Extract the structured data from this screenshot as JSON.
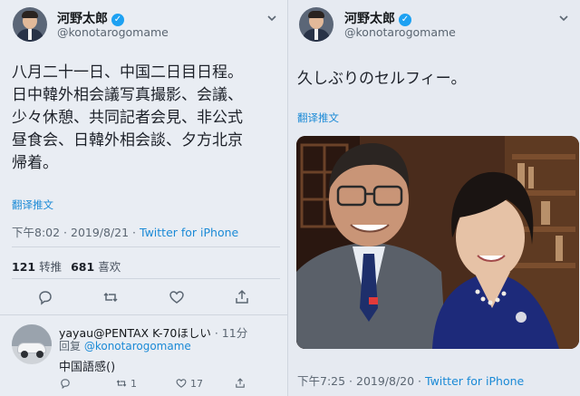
{
  "left_tweet": {
    "author_name": "河野太郎",
    "author_handle": "@konotarogomame",
    "text_lines": [
      "八月二十一日、中国二日目日程。",
      "日中韓外相会議写真撮影、会議、",
      "少々休憩、共同記者会見、非公式",
      "昼食会、日韓外相会談、夕方北京",
      "帰着。"
    ],
    "translate_label": "翻译推文",
    "time": "下午8:02 · 2019/8/21 · ",
    "source": "Twitter for iPhone",
    "retweets_count": "121",
    "retweets_label": "转推",
    "likes_count": "681",
    "likes_label": "喜欢"
  },
  "reply": {
    "name": "yayau@PENTAX K-70ほしい",
    "time": " · 11分",
    "reply_prefix": "回复 ",
    "reply_mention": "@konotarogomame",
    "text": "中国語感()",
    "retweet_count": "1",
    "like_count": "17"
  },
  "right_tweet": {
    "author_name": "河野太郎",
    "author_handle": "@konotarogomame",
    "text": "久しぶりのセルフィー。",
    "translate_label": "翻译推文",
    "time": "下午7:25 · 2019/8/20 · ",
    "source": "Twitter for iPhone"
  },
  "colors": {
    "accent": "#1b8ad6",
    "verified": "#1da1f2",
    "text": "#1d2129",
    "muted": "#5b6672"
  },
  "icons": [
    "verified-badge-icon",
    "chevron-down-icon",
    "reply-icon",
    "retweet-icon",
    "like-icon",
    "share-icon"
  ]
}
